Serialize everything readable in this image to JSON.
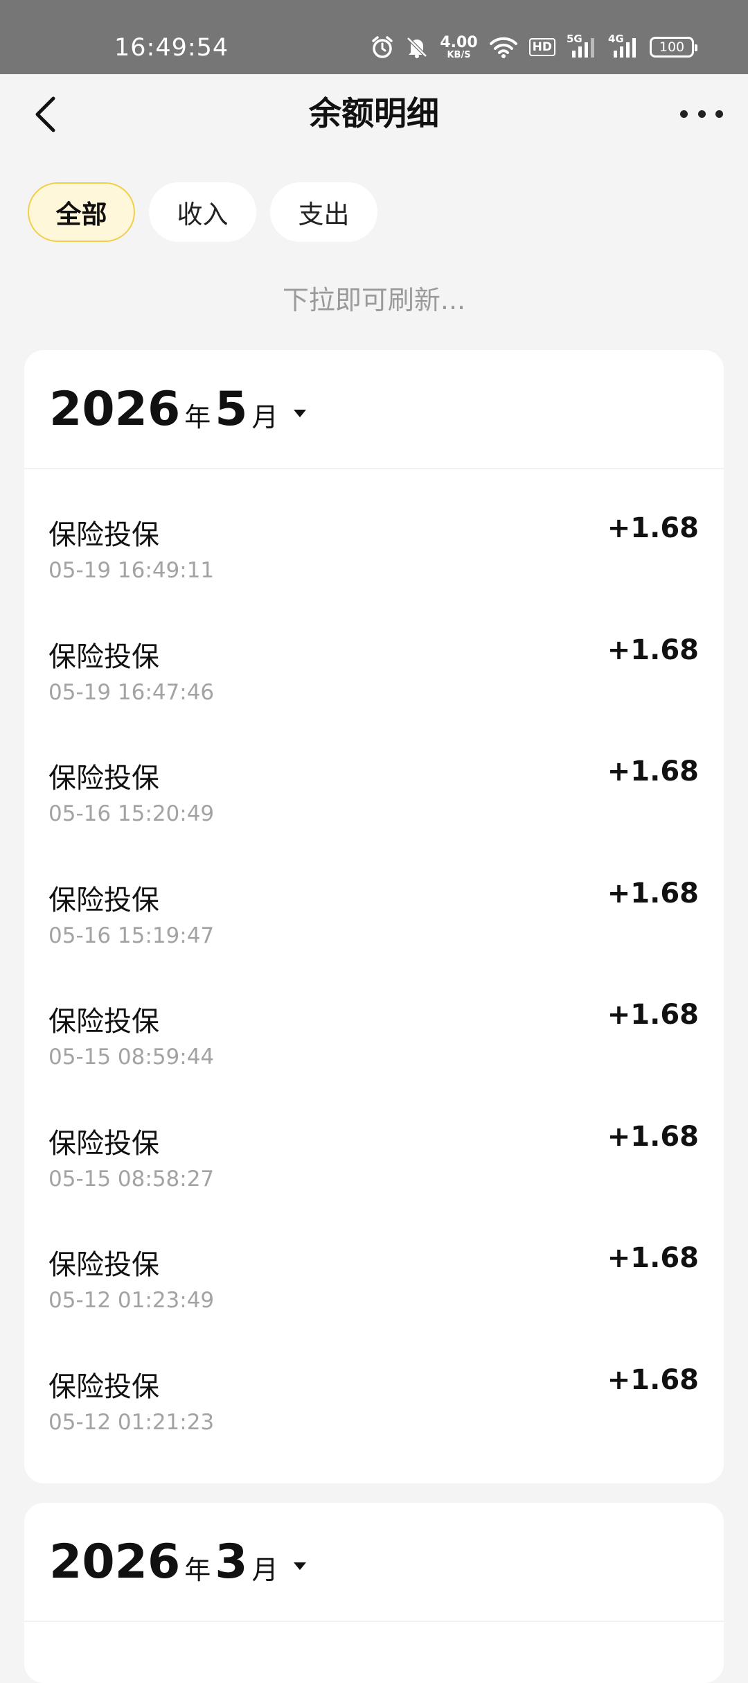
{
  "status_bar": {
    "time": "16:49:54",
    "net_speed_value": "4.00",
    "net_speed_unit": "KB/S",
    "hd_label": "HD",
    "sim1_label": "5G",
    "sim2_label": "4G",
    "battery": "100",
    "icons": [
      "alarm-icon",
      "mute-icon",
      "wifi-icon",
      "signal-icon"
    ]
  },
  "header": {
    "title": "余额明细"
  },
  "tabs": [
    {
      "label": "全部",
      "active": true
    },
    {
      "label": "收入",
      "active": false
    },
    {
      "label": "支出",
      "active": false
    }
  ],
  "refresh_hint": "下拉即可刷新...",
  "groups": [
    {
      "year": "2026",
      "year_unit": "年",
      "month": "5",
      "month_unit": "月",
      "items": [
        {
          "title": "保险投保",
          "time": "05-19 16:49:11",
          "amount": "+1.68"
        },
        {
          "title": "保险投保",
          "time": "05-19 16:47:46",
          "amount": "+1.68"
        },
        {
          "title": "保险投保",
          "time": "05-16 15:20:49",
          "amount": "+1.68"
        },
        {
          "title": "保险投保",
          "time": "05-16 15:19:47",
          "amount": "+1.68"
        },
        {
          "title": "保险投保",
          "time": "05-15 08:59:44",
          "amount": "+1.68"
        },
        {
          "title": "保险投保",
          "time": "05-15 08:58:27",
          "amount": "+1.68"
        },
        {
          "title": "保险投保",
          "time": "05-12 01:23:49",
          "amount": "+1.68"
        },
        {
          "title": "保险投保",
          "time": "05-12 01:21:23",
          "amount": "+1.68"
        }
      ]
    },
    {
      "year": "2026",
      "year_unit": "年",
      "month": "3",
      "month_unit": "月",
      "items": []
    }
  ]
}
